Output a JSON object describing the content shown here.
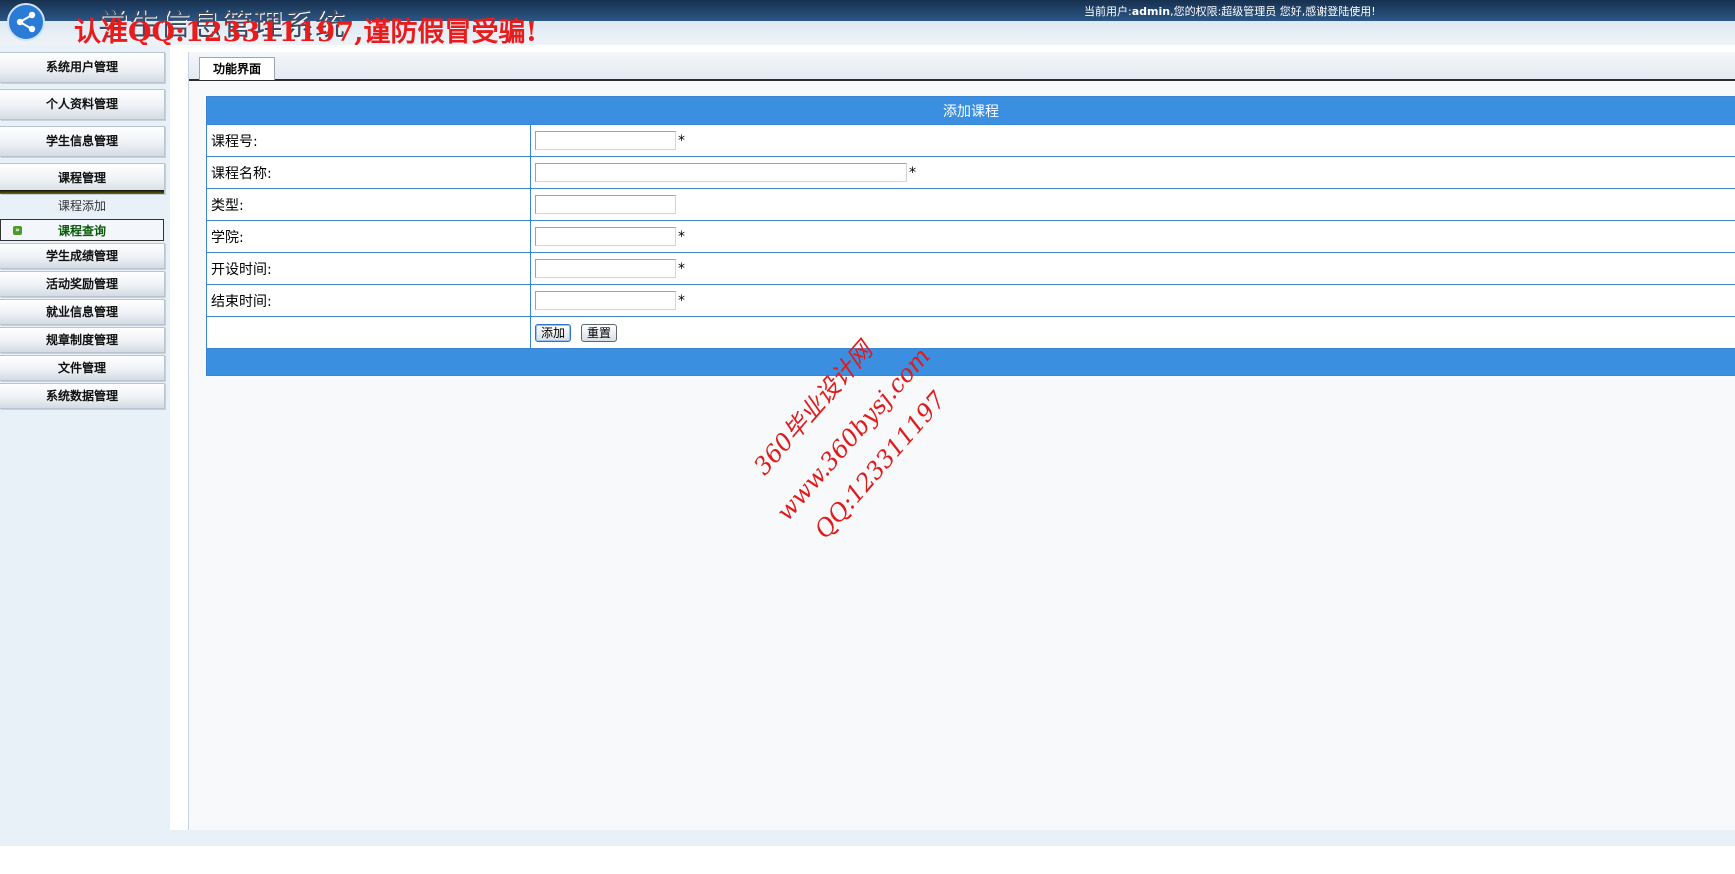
{
  "header": {
    "app_title": "学生信息管理系统",
    "warning_text": "认准QQ:123311197,谨防假冒受骗!",
    "user_prefix": "当前用户:",
    "user_name": "admin",
    "role_prefix": ",您的权限:",
    "role": "超级管理员",
    "welcome": "您好,感谢登陆使用!"
  },
  "sidebar": {
    "items": [
      {
        "label": "系统用户管理"
      },
      {
        "label": "个人资料管理"
      },
      {
        "label": "学生信息管理"
      },
      {
        "label": "课程管理"
      },
      {
        "label": "学生成绩管理"
      },
      {
        "label": "活动奖励管理"
      },
      {
        "label": "就业信息管理"
      },
      {
        "label": "规章制度管理"
      },
      {
        "label": "文件管理"
      },
      {
        "label": "系统数据管理"
      }
    ],
    "sub_items": [
      {
        "label": "课程添加"
      },
      {
        "label": "课程查询"
      }
    ]
  },
  "main": {
    "tab_label": "功能界面",
    "form": {
      "title": "添加课程",
      "fields": [
        {
          "label": "课程号:",
          "value": "",
          "required": "*"
        },
        {
          "label": "课程名称:",
          "value": "",
          "required": "*"
        },
        {
          "label": "类型:",
          "value": "",
          "required": ""
        },
        {
          "label": "学院:",
          "value": "",
          "required": "*"
        },
        {
          "label": "开设时间:",
          "value": "",
          "required": "*"
        },
        {
          "label": "结束时间:",
          "value": "",
          "required": "*"
        }
      ],
      "submit_label": "添加",
      "reset_label": "重置"
    }
  },
  "watermark": {
    "line1": "360毕业设计网",
    "line2": "www.360bysj.com",
    "line3": "QQ:123311197"
  },
  "colors": {
    "form_header": "#3b8fe0",
    "form_border": "#3b86d4",
    "warning": "#e81c1c",
    "sidebar_bg": "#e8f0f8"
  }
}
